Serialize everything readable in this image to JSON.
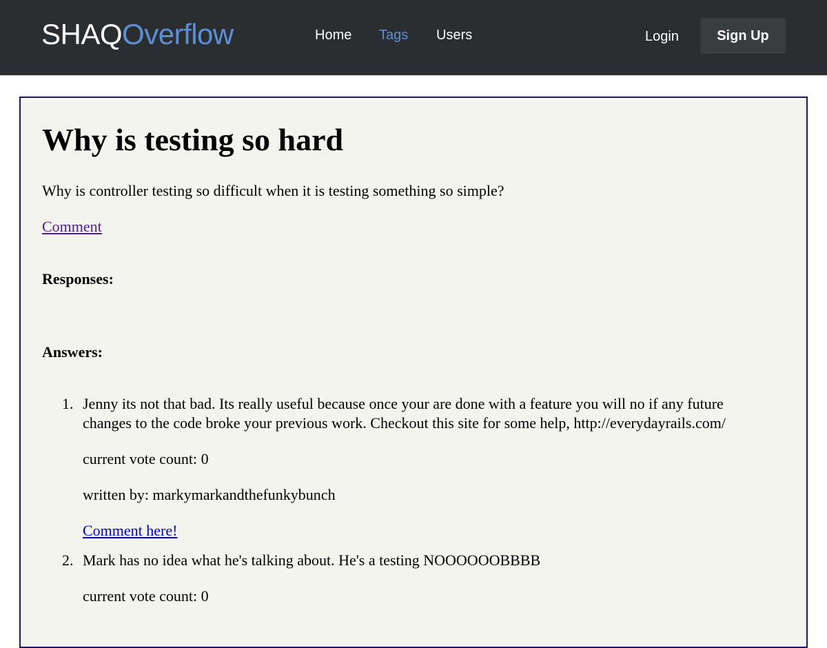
{
  "header": {
    "brand_part1": "SHAQ",
    "brand_part2": "Overflow",
    "nav": [
      {
        "label": "Home",
        "active": false
      },
      {
        "label": "Tags",
        "active": true
      },
      {
        "label": "Users",
        "active": false
      }
    ],
    "login_label": "Login",
    "signup_label": "Sign Up",
    "colors": {
      "bar": "#2b2e31",
      "accent": "#5b8fd8",
      "signup_bg": "#3a3d40"
    }
  },
  "question": {
    "title": "Why is testing so hard",
    "body": "Why is controller testing so difficult when it is testing something so simple?",
    "comment_link": "Comment"
  },
  "sections": {
    "responses_heading": "Responses:",
    "answers_heading": "Answers:"
  },
  "answers": [
    {
      "number": "1.",
      "text_line1": "Jenny its not that bad. Its really useful because once your are done with a feature you will no if any future",
      "text_line2": "changes to the code broke your previous work. Checkout this site for some help, http://everydayrails.com/",
      "vote_count": "current vote count: 0",
      "author": "written by: markymarkandthefunkybunch",
      "comment_link": "Comment here!"
    },
    {
      "number": "2.",
      "text_line1": "Mark has no idea what he's talking about. He's a testing NOOOOOOBBBB",
      "vote_count": "current vote count: 0"
    }
  ],
  "colors": {
    "panel_bg": "#f4f4ef",
    "panel_border": "#1b1a5c",
    "visited_link": "#551a8b",
    "link": "#0000ee"
  }
}
